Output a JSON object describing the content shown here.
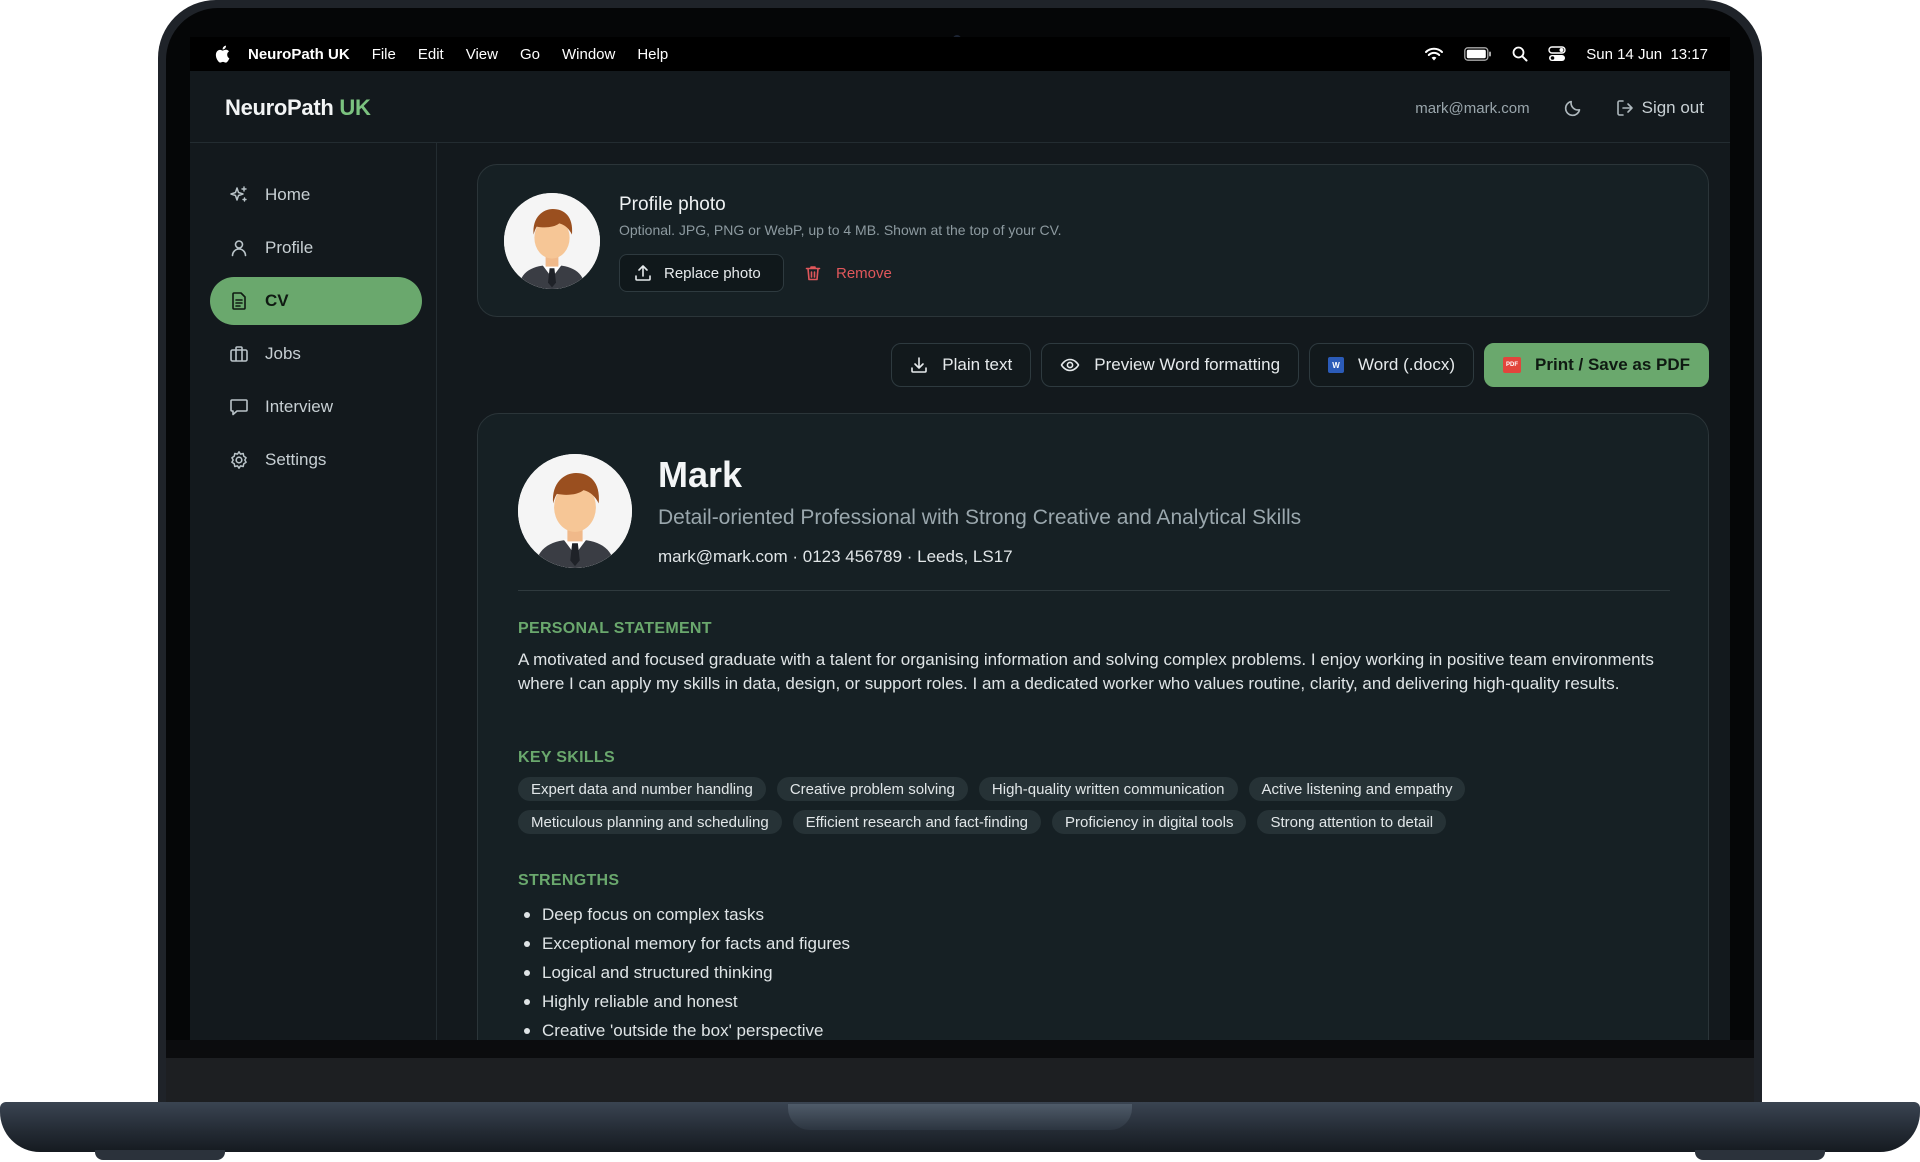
{
  "menubar": {
    "app_name": "NeuroPath UK",
    "menus": [
      "File",
      "Edit",
      "View",
      "Go",
      "Window",
      "Help"
    ],
    "datetime": "Sun 14 Jun  13:17"
  },
  "header": {
    "brand_main": "NeuroPath",
    "brand_accent": "UK",
    "user_email": "mark@mark.com",
    "signout_label": "Sign out"
  },
  "sidebar": {
    "items": [
      {
        "label": "Home",
        "icon": "sparkle-icon"
      },
      {
        "label": "Profile",
        "icon": "user-icon"
      },
      {
        "label": "CV",
        "icon": "document-icon",
        "active": true
      },
      {
        "label": "Jobs",
        "icon": "briefcase-icon"
      },
      {
        "label": "Interview",
        "icon": "chat-icon"
      },
      {
        "label": "Settings",
        "icon": "gear-icon"
      }
    ]
  },
  "photo_card": {
    "title": "Profile photo",
    "subtitle": "Optional. JPG, PNG or WebP, up to 4 MB. Shown at the top of your CV.",
    "replace_label": "Replace photo",
    "remove_label": "Remove"
  },
  "export": {
    "plain_text": "Plain text",
    "preview_word": "Preview Word formatting",
    "word_docx": "Word (.docx)",
    "print_pdf": "Print / Save as PDF",
    "word_badge": "W",
    "pdf_badge": "PDF"
  },
  "cv": {
    "name": "Mark",
    "headline": "Detail-oriented Professional with Strong Creative and Analytical Skills",
    "contact": "mark@mark.com · 0123 456789 · Leeds, LS17",
    "personal_statement_title": "PERSONAL STATEMENT",
    "personal_statement": "A motivated and focused graduate with a talent for organising information and solving complex problems. I enjoy working in positive team environments where I can apply my skills in data, design, or support roles. I am a dedicated worker who values routine, clarity, and delivering high-quality results.",
    "key_skills_title": "KEY SKILLS",
    "key_skills": [
      "Expert data and number handling",
      "Creative problem solving",
      "High-quality written communication",
      "Active listening and empathy",
      "Meticulous planning and scheduling",
      "Efficient research and fact-finding",
      "Proficiency in digital tools",
      "Strong attention to detail"
    ],
    "strengths_title": "STRENGTHS",
    "strengths": [
      "Deep focus on complex tasks",
      "Exceptional memory for facts and figures",
      "Logical and structured thinking",
      "Highly reliable and honest",
      "Creative 'outside the box' perspective"
    ]
  },
  "colors": {
    "accent": "#6aa86d",
    "danger": "#e0575b",
    "background": "#13191d"
  }
}
